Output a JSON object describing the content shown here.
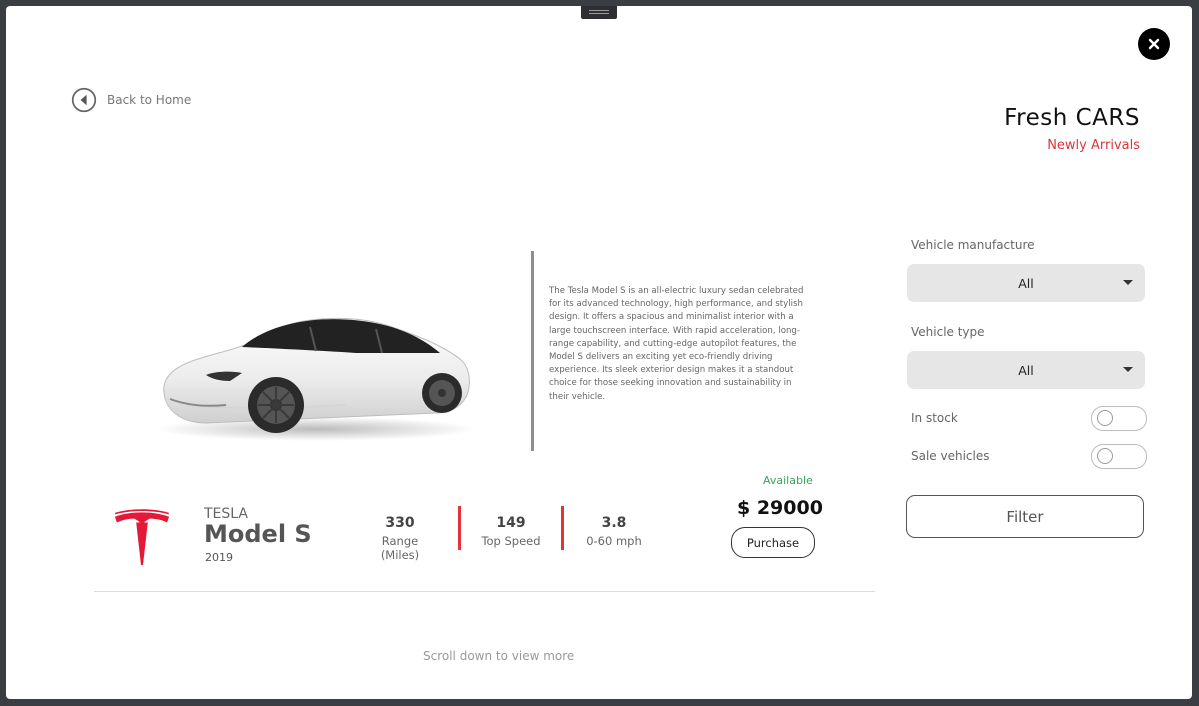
{
  "nav": {
    "back_label": "Back to Home"
  },
  "brand": {
    "title": "Fresh CARS",
    "subtitle": "Newly Arrivals"
  },
  "car": {
    "description": "The Tesla Model S is an all-electric luxury sedan celebrated for its advanced technology, high performance, and stylish design. It offers a spacious and minimalist interior with a large touchscreen interface. With rapid acceleration, long-range capability, and cutting-edge autopilot features, the Model S delivers an exciting yet eco-friendly driving experience. Its sleek exterior design makes it a standout choice for those seeking innovation and sustainability in their vehicle.",
    "make": "TESLA",
    "model": "Model S",
    "year": "2019",
    "stats": [
      {
        "value": "330",
        "label": "Range (Miles)"
      },
      {
        "value": "149",
        "label": "Top Speed"
      },
      {
        "value": "3.8",
        "label": "0-60 mph"
      }
    ],
    "availability": "Available",
    "price": "$ 29000",
    "purchase_label": "Purchase",
    "color": "white"
  },
  "filters": {
    "manufacture_label": "Vehicle manufacture",
    "manufacture_value": "All",
    "type_label": "Vehicle type",
    "type_value": "All",
    "in_stock_label": "In stock",
    "in_stock_on": false,
    "sale_label": "Sale vehicles",
    "sale_on": false,
    "filter_label": "Filter"
  },
  "footer": {
    "scroll_hint": "Scroll down to view more"
  },
  "colors": {
    "accent": "#e0343a",
    "available": "#3aa35a",
    "background": "#ffffff"
  },
  "icons": {
    "close": "close-icon",
    "back": "back-arrow-icon",
    "logo": "tesla-logo",
    "dropdown": "chevron-down-icon"
  }
}
